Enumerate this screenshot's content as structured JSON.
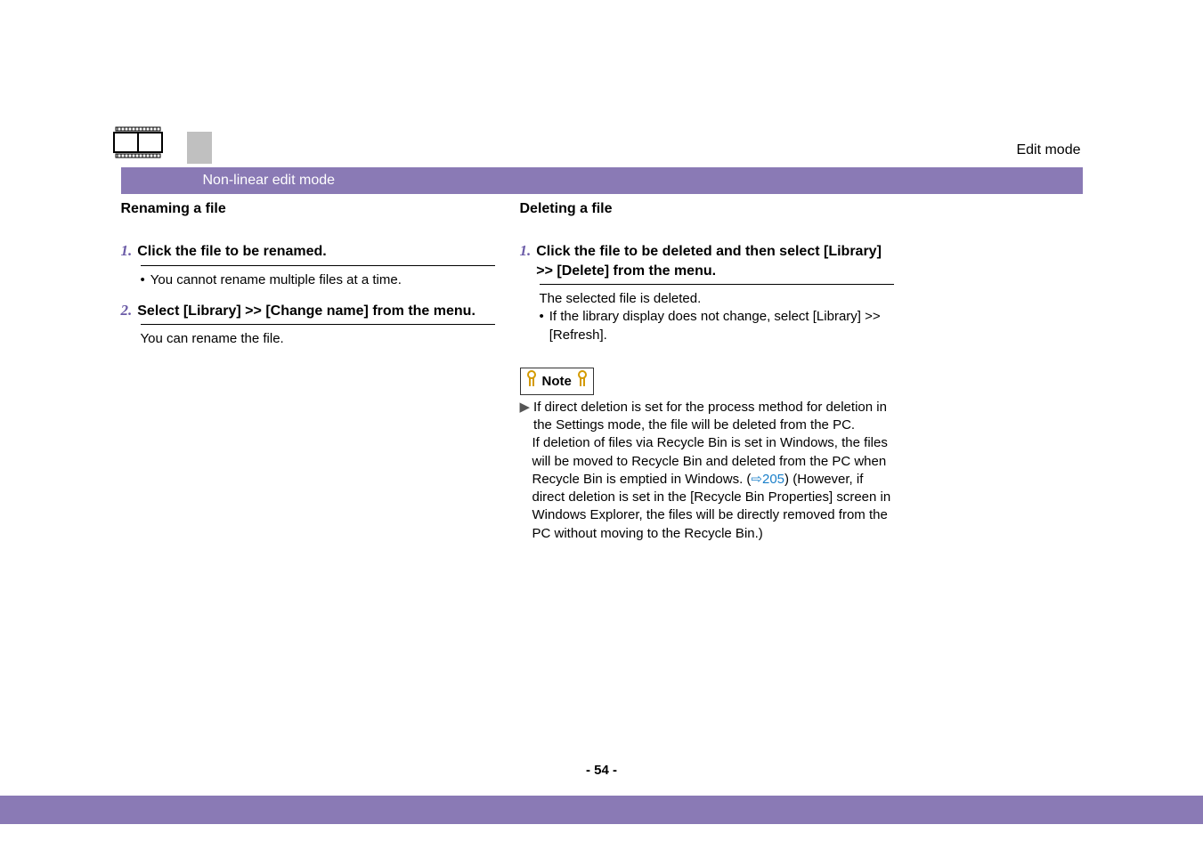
{
  "header": {
    "edit_mode": "Edit mode",
    "banner": "Non-linear edit mode"
  },
  "left": {
    "section_title": "Renaming a file",
    "steps": [
      {
        "num": "1.",
        "title": "Click the file to be renamed.",
        "bullets": [
          "You cannot rename multiple files at a time."
        ],
        "after": []
      },
      {
        "num": "2.",
        "title": "Select [Library] >> [Change name] from the menu.",
        "bullets": [],
        "after": [
          "You can rename the file."
        ]
      }
    ]
  },
  "right": {
    "section_title": "Deleting a file",
    "steps": [
      {
        "num": "1.",
        "title": "Click the file to be deleted and then select [Library] >> [Delete] from the menu.",
        "after": [
          "The selected file is deleted."
        ],
        "bullets": [
          "If the library display does not change, select [Library] >> [Refresh]."
        ]
      }
    ],
    "note_label": "Note",
    "note_para1": "If direct deletion is set for the process method for deletion in the Settings mode, the file will be deleted from the PC.",
    "note_para2a": "If deletion of files via Recycle Bin is set in Windows, the files will be moved to Recycle Bin and deleted from the PC when Recycle Bin is emptied in Windows. (",
    "note_link_arrow": "⇨",
    "note_link_num": "205",
    "note_para2b": ") (However, if direct deletion is set in the [Recycle Bin Properties] screen in Windows Explorer, the files will be directly removed from the PC without moving to the Recycle Bin.)"
  },
  "page_number": "- 54 -"
}
